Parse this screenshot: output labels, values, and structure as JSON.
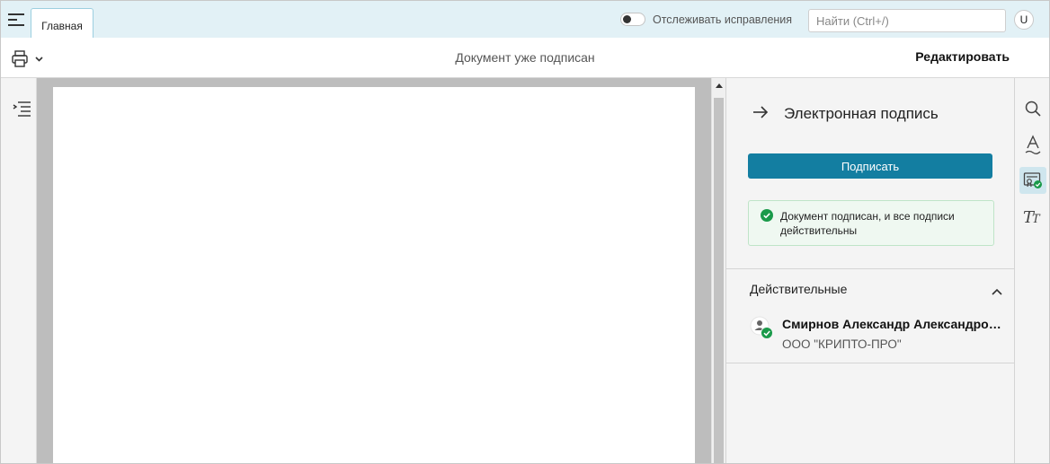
{
  "topbar": {
    "tab_main": "Главная",
    "track_changes_label": "Отслеживать исправления",
    "track_changes_on": false,
    "search_placeholder": "Найти (Ctrl+/)",
    "user_initial": "U"
  },
  "toolbar": {
    "doc_status": "Документ уже подписан",
    "edit_label": "Редактировать"
  },
  "panel": {
    "title": "Электронная подпись",
    "sign_button": "Подписать",
    "status_message": "Документ подписан, и все подписи действительны",
    "valid_section_title": "Действительные",
    "signers": [
      {
        "name": "Смирнов Александр Александрович",
        "organization": "ООО \"КРИПТО-ПРО\"",
        "valid": true
      }
    ]
  },
  "right_rail": {
    "buttons": [
      "search-icon",
      "text-style-icon",
      "signature-icon",
      "font-size-icon"
    ],
    "active": "signature-icon"
  },
  "colors": {
    "accent": "#137ea1",
    "topbar_bg": "#e2f1f6",
    "success": "#1a9a4a",
    "success_bg": "#eff8f1",
    "document_bg": "#bdbdbd"
  }
}
